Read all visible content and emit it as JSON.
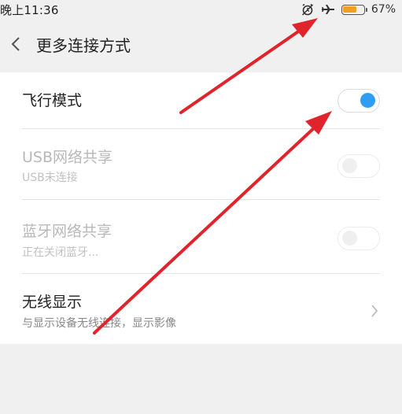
{
  "status_bar": {
    "time": "晚上11:36",
    "battery_percent_label": "67%",
    "battery_level": 0.67,
    "icons": [
      "alarm-off-icon",
      "airplane-icon",
      "battery-icon"
    ],
    "battery_color": "#f0a020"
  },
  "header": {
    "title": "更多连接方式",
    "back_icon": "chevron-left-icon"
  },
  "items": [
    {
      "title": "飞行模式",
      "subtitle": "",
      "control": "toggle",
      "state": "on",
      "enabled": true
    },
    {
      "title": "USB网络共享",
      "subtitle": "USB未连接",
      "control": "toggle",
      "state": "off",
      "enabled": false
    },
    {
      "title": "蓝牙网络共享",
      "subtitle": "正在关闭蓝牙...",
      "control": "toggle",
      "state": "off",
      "enabled": false
    },
    {
      "title": "无线显示",
      "subtitle": "与显示设备无线连接，显示影像",
      "control": "chevron",
      "enabled": true
    }
  ],
  "colors": {
    "accent": "#2f9df3",
    "annotation_arrow": "#e0242b",
    "background": "#f1f0f0"
  }
}
